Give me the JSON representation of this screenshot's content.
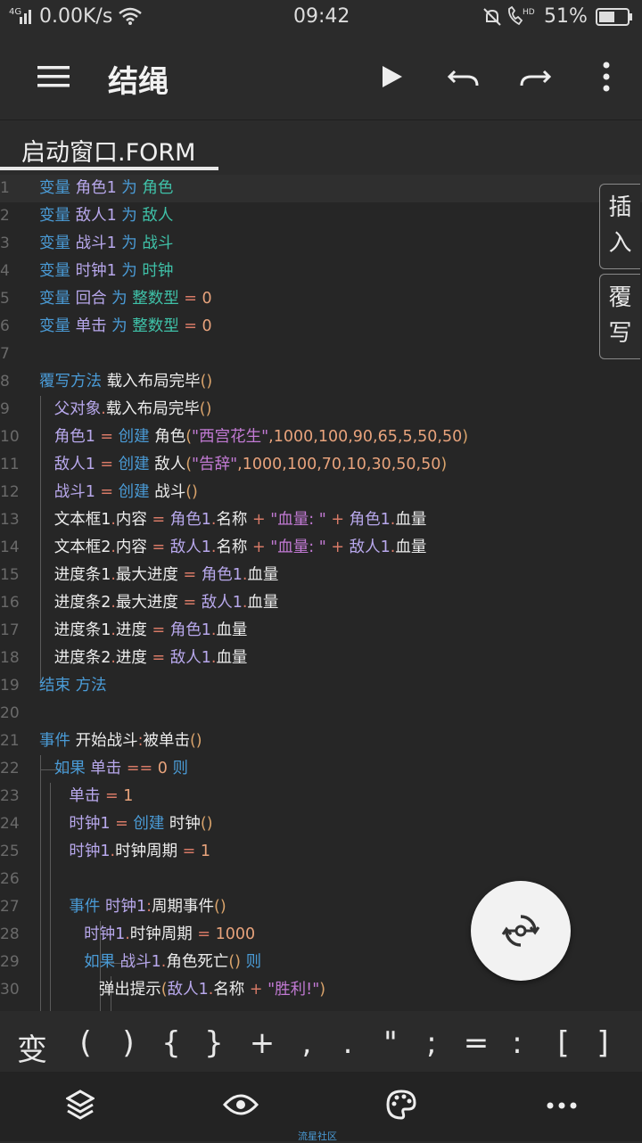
{
  "status": {
    "carrier": "4G",
    "speed": "0.00K/s",
    "time": "09:42",
    "battery": "51%"
  },
  "app": {
    "title": "结绳"
  },
  "tab": {
    "label": "启动窗口.FORM"
  },
  "side_buttons": {
    "insert": [
      "插",
      "入"
    ],
    "overwrite": [
      "覆",
      "写"
    ]
  },
  "symbols": [
    "变",
    "(",
    ")",
    "{",
    "}",
    "+",
    ",",
    ".",
    "\"",
    ";",
    "=",
    ":",
    "[",
    "]"
  ],
  "watermark": "流星社区",
  "colors": {
    "keyword": "#4a9bd6",
    "type": "#3fc1a8",
    "identifier": "#b8a8ec",
    "operator": "#d87a67",
    "number": "#e8a37c",
    "string": "#c27ad4"
  },
  "icons": [
    "menu-icon",
    "play-icon",
    "undo-icon",
    "redo-icon",
    "more-vert-icon",
    "layers-icon",
    "eye-icon",
    "palette-icon",
    "more-horiz-icon",
    "fab-icon"
  ],
  "code": [
    {
      "n": "1",
      "t": [
        [
          "kw",
          "变量"
        ],
        [
          "id",
          " 角色1 "
        ],
        [
          "kw",
          "为"
        ],
        [
          "ty",
          " 角色"
        ]
      ]
    },
    {
      "n": "2",
      "t": [
        [
          "kw",
          "变量"
        ],
        [
          "id",
          " 敌人1 "
        ],
        [
          "kw",
          "为"
        ],
        [
          "ty",
          " 敌人"
        ]
      ]
    },
    {
      "n": "3",
      "t": [
        [
          "kw",
          "变量"
        ],
        [
          "id",
          " 战斗1 "
        ],
        [
          "kw",
          "为"
        ],
        [
          "ty",
          " 战斗"
        ]
      ]
    },
    {
      "n": "4",
      "t": [
        [
          "kw",
          "变量"
        ],
        [
          "id",
          " 时钟1 "
        ],
        [
          "kw",
          "为"
        ],
        [
          "ty",
          " 时钟"
        ]
      ]
    },
    {
      "n": "5",
      "t": [
        [
          "kw",
          "变量"
        ],
        [
          "id",
          " 回合 "
        ],
        [
          "kw",
          "为"
        ],
        [
          "ty",
          " 整数型"
        ],
        [
          "op",
          " = "
        ],
        [
          "nu",
          "0"
        ]
      ]
    },
    {
      "n": "6",
      "t": [
        [
          "kw",
          "变量"
        ],
        [
          "id",
          " 单击 "
        ],
        [
          "kw",
          "为"
        ],
        [
          "ty",
          " 整数型"
        ],
        [
          "op",
          " = "
        ],
        [
          "nu",
          "0"
        ]
      ]
    },
    {
      "n": "7",
      "t": []
    },
    {
      "n": "8",
      "t": [
        [
          "kw",
          "覆写方法"
        ],
        [
          "pl",
          " 载入布局完毕"
        ],
        [
          "pa",
          "()"
        ]
      ]
    },
    {
      "n": "9",
      "t": [
        [
          "pl",
          "   "
        ],
        [
          "id",
          "父对象"
        ],
        [
          "op",
          "."
        ],
        [
          "pl",
          "载入布局完毕"
        ],
        [
          "pa",
          "()"
        ]
      ]
    },
    {
      "n": "10",
      "t": [
        [
          "pl",
          "   "
        ],
        [
          "id",
          "角色1"
        ],
        [
          "op",
          " = "
        ],
        [
          "kw",
          "创建"
        ],
        [
          "pl",
          " 角色"
        ],
        [
          "pa",
          "("
        ],
        [
          "st",
          "\"西宫花生\""
        ],
        [
          "nu",
          ",1000,100,90,65,5,50,50"
        ],
        [
          "pa",
          ")"
        ]
      ]
    },
    {
      "n": "11",
      "t": [
        [
          "pl",
          "   "
        ],
        [
          "id",
          "敌人1"
        ],
        [
          "op",
          " = "
        ],
        [
          "kw",
          "创建"
        ],
        [
          "pl",
          " 敌人"
        ],
        [
          "pa",
          "("
        ],
        [
          "st",
          "\"告辞\""
        ],
        [
          "nu",
          ",1000,100,70,10,30,50,50"
        ],
        [
          "pa",
          ")"
        ]
      ]
    },
    {
      "n": "12",
      "t": [
        [
          "pl",
          "   "
        ],
        [
          "id",
          "战斗1"
        ],
        [
          "op",
          " = "
        ],
        [
          "kw",
          "创建"
        ],
        [
          "pl",
          " 战斗"
        ],
        [
          "pa",
          "()"
        ]
      ]
    },
    {
      "n": "13",
      "t": [
        [
          "pl",
          "   文本框1"
        ],
        [
          "op",
          "."
        ],
        [
          "pl",
          "内容 "
        ],
        [
          "op",
          "= "
        ],
        [
          "id",
          "角色1"
        ],
        [
          "op",
          "."
        ],
        [
          "pl",
          "名称 "
        ],
        [
          "op",
          "+ "
        ],
        [
          "st",
          "\"血量: \""
        ],
        [
          "op",
          " + "
        ],
        [
          "id",
          "角色1"
        ],
        [
          "op",
          "."
        ],
        [
          "pl",
          "血量"
        ]
      ]
    },
    {
      "n": "14",
      "t": [
        [
          "pl",
          "   文本框2"
        ],
        [
          "op",
          "."
        ],
        [
          "pl",
          "内容 "
        ],
        [
          "op",
          "= "
        ],
        [
          "id",
          "敌人1"
        ],
        [
          "op",
          "."
        ],
        [
          "pl",
          "名称 "
        ],
        [
          "op",
          "+ "
        ],
        [
          "st",
          "\"血量: \""
        ],
        [
          "op",
          " + "
        ],
        [
          "id",
          "敌人1"
        ],
        [
          "op",
          "."
        ],
        [
          "pl",
          "血量"
        ]
      ]
    },
    {
      "n": "15",
      "t": [
        [
          "pl",
          "   进度条1"
        ],
        [
          "op",
          "."
        ],
        [
          "pl",
          "最大进度 "
        ],
        [
          "op",
          "= "
        ],
        [
          "id",
          "角色1"
        ],
        [
          "op",
          "."
        ],
        [
          "pl",
          "血量"
        ]
      ]
    },
    {
      "n": "16",
      "t": [
        [
          "pl",
          "   进度条2"
        ],
        [
          "op",
          "."
        ],
        [
          "pl",
          "最大进度 "
        ],
        [
          "op",
          "= "
        ],
        [
          "id",
          "敌人1"
        ],
        [
          "op",
          "."
        ],
        [
          "pl",
          "血量"
        ]
      ]
    },
    {
      "n": "17",
      "t": [
        [
          "pl",
          "   进度条1"
        ],
        [
          "op",
          "."
        ],
        [
          "pl",
          "进度 "
        ],
        [
          "op",
          "= "
        ],
        [
          "id",
          "角色1"
        ],
        [
          "op",
          "."
        ],
        [
          "pl",
          "血量"
        ]
      ]
    },
    {
      "n": "18",
      "t": [
        [
          "pl",
          "   进度条2"
        ],
        [
          "op",
          "."
        ],
        [
          "pl",
          "进度 "
        ],
        [
          "op",
          "= "
        ],
        [
          "id",
          "敌人1"
        ],
        [
          "op",
          "."
        ],
        [
          "pl",
          "血量"
        ]
      ]
    },
    {
      "n": "19",
      "t": [
        [
          "kw",
          "结束 方法"
        ]
      ]
    },
    {
      "n": "20",
      "t": []
    },
    {
      "n": "21",
      "t": [
        [
          "kw",
          "事件"
        ],
        [
          "pl",
          " 开始战斗"
        ],
        [
          "op",
          ":"
        ],
        [
          "pl",
          "被单击"
        ],
        [
          "pa",
          "()"
        ]
      ]
    },
    {
      "n": "22",
      "t": [
        [
          "pl",
          "   "
        ],
        [
          "kw",
          "如果"
        ],
        [
          "id",
          " 单击"
        ],
        [
          "op",
          " == "
        ],
        [
          "nu",
          "0"
        ],
        [
          "kw",
          " 则"
        ]
      ]
    },
    {
      "n": "23",
      "t": [
        [
          "pl",
          "      "
        ],
        [
          "id",
          "单击"
        ],
        [
          "op",
          " = "
        ],
        [
          "nu",
          "1"
        ]
      ]
    },
    {
      "n": "24",
      "t": [
        [
          "pl",
          "      "
        ],
        [
          "id",
          "时钟1"
        ],
        [
          "op",
          " = "
        ],
        [
          "kw",
          "创建"
        ],
        [
          "pl",
          " 时钟"
        ],
        [
          "pa",
          "()"
        ]
      ]
    },
    {
      "n": "25",
      "t": [
        [
          "pl",
          "      "
        ],
        [
          "id",
          "时钟1"
        ],
        [
          "op",
          "."
        ],
        [
          "pl",
          "时钟周期 "
        ],
        [
          "op",
          "= "
        ],
        [
          "nu",
          "1"
        ]
      ]
    },
    {
      "n": "26",
      "t": []
    },
    {
      "n": "27",
      "t": [
        [
          "pl",
          "      "
        ],
        [
          "kw",
          "事件"
        ],
        [
          "id",
          " 时钟1"
        ],
        [
          "op",
          ":"
        ],
        [
          "pl",
          "周期事件"
        ],
        [
          "pa",
          "()"
        ]
      ]
    },
    {
      "n": "28",
      "t": [
        [
          "pl",
          "         "
        ],
        [
          "id",
          "时钟1"
        ],
        [
          "op",
          "."
        ],
        [
          "pl",
          "时钟周期 "
        ],
        [
          "op",
          "= "
        ],
        [
          "nu",
          "1000"
        ]
      ]
    },
    {
      "n": "29",
      "t": [
        [
          "pl",
          "         "
        ],
        [
          "kw",
          "如果"
        ],
        [
          "id",
          " 战斗1"
        ],
        [
          "op",
          "."
        ],
        [
          "pl",
          "角色死亡"
        ],
        [
          "pa",
          "()"
        ],
        [
          "kw",
          " 则"
        ]
      ]
    },
    {
      "n": "30",
      "t": [
        [
          "pl",
          "            弹出提示"
        ],
        [
          "pa",
          "("
        ],
        [
          "id",
          "敌人1"
        ],
        [
          "op",
          "."
        ],
        [
          "pl",
          "名称 "
        ],
        [
          "op",
          "+ "
        ],
        [
          "st",
          "\"胜利!\""
        ],
        [
          "pa",
          ")"
        ]
      ]
    }
  ]
}
